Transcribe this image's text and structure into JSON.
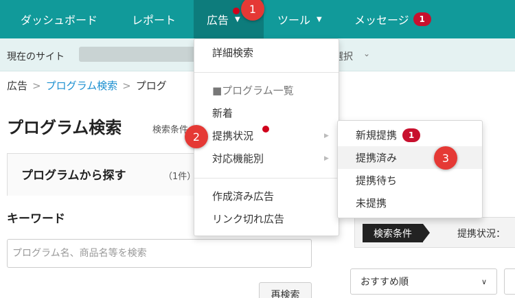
{
  "navbar": {
    "items": [
      {
        "label": "ダッシュボード"
      },
      {
        "label": "レポート"
      },
      {
        "label": "広告"
      },
      {
        "label": "ツール"
      },
      {
        "label": "メッセージ",
        "badge": "1"
      }
    ],
    "active": "広告"
  },
  "sitebar": {
    "label": "現在のサイト",
    "select_label": "選択"
  },
  "breadcrumb": {
    "root": "広告",
    "parent": "プログラム検索",
    "current": "プログ"
  },
  "page": {
    "title": "プログラム検索",
    "search_conditions_link": "検索条件"
  },
  "program_tab": {
    "title": "プログラムから探す",
    "count": "（1件）"
  },
  "keyword": {
    "label": "キーワード",
    "placeholder": "プログラム名、商品名等を検索",
    "research_button": "再検索"
  },
  "search_conditions": {
    "tag": "検索条件",
    "status": "提携状況："
  },
  "sort": {
    "selected": "おすすめ順"
  },
  "ad_menu": {
    "detailed_search": "詳細検索",
    "program_list_header": "■プログラム一覧",
    "new_items": "新着",
    "partnership_status": "提携状況",
    "by_feature": "対応機能別",
    "created_ads": "作成済み広告",
    "broken_link_ads": "リンク切れ広告"
  },
  "partnership_submenu": {
    "items": [
      {
        "label": "新規提携",
        "badge": "1"
      },
      {
        "label": "提携済み"
      },
      {
        "label": "提携待ち"
      },
      {
        "label": "未提携"
      }
    ],
    "hovered": "提携済み"
  },
  "steps": [
    "1",
    "2",
    "3"
  ],
  "colors": {
    "navbar": "#119a9a",
    "navbar_active": "#0d7c7c",
    "sitebar": "#e5f2f2",
    "badge": "#c8102e",
    "step_marker": "#e53935",
    "link": "#1a8fd0"
  }
}
